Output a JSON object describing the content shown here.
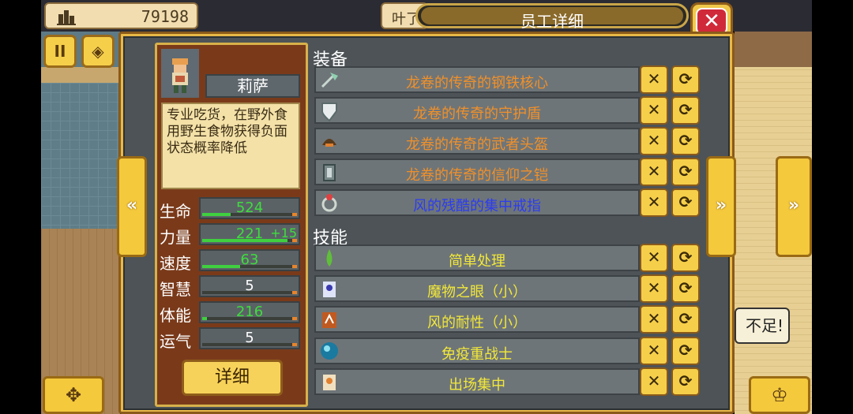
{
  "topbar": {
    "money": "79198",
    "name_partial": "叶了",
    "title": "员工详细",
    "close_label": "✕"
  },
  "left_buttons": {
    "pause_label": "II",
    "map_label": "◈"
  },
  "character": {
    "name": "莉萨",
    "description": "专业吃货，在野外食用野生食物获得负面状态概率降低",
    "stats": [
      {
        "label": "生命",
        "value": "524",
        "color": "#3fdc3f",
        "fill": 0.3
      },
      {
        "label": "力量",
        "value": "221",
        "bonus": "+15",
        "color": "#3fdc3f",
        "fill": 0.9
      },
      {
        "label": "速度",
        "value": "63",
        "color": "#3fdc3f",
        "fill": 0.4
      },
      {
        "label": "智慧",
        "value": "5",
        "color": "#ffffff",
        "fill": 0.0
      },
      {
        "label": "体能",
        "value": "216",
        "color": "#3fdc3f",
        "fill": 0.05
      },
      {
        "label": "运气",
        "value": "5",
        "color": "#ffffff",
        "fill": 0.0
      }
    ],
    "detail_button": "详细"
  },
  "equipment": {
    "title": "装备",
    "items": [
      {
        "name": "龙卷的传奇的钢铁核心",
        "color": "#f0902a",
        "icon": "axe-icon"
      },
      {
        "name": "龙卷的传奇的守护盾",
        "color": "#f0902a",
        "icon": "shield-icon"
      },
      {
        "name": "龙卷的传奇的武者头盔",
        "color": "#f0902a",
        "icon": "helmet-icon"
      },
      {
        "name": "龙卷的传奇的信仰之铠",
        "color": "#f0902a",
        "icon": "armor-icon"
      },
      {
        "name": "风的残酷的集中戒指",
        "color": "#2c3cf0",
        "icon": "ring-icon"
      }
    ]
  },
  "skills": {
    "title": "技能",
    "items": [
      {
        "name": "简单处理",
        "color": "#f2e83a",
        "icon": "potion-icon"
      },
      {
        "name": "魔物之眼（小）",
        "color": "#f2e83a",
        "icon": "monster-eye-icon"
      },
      {
        "name": "风的耐性（小）",
        "color": "#f2e83a",
        "icon": "wind-icon"
      },
      {
        "name": "免疫重战士",
        "color": "#f2e83a",
        "icon": "orb-icon"
      },
      {
        "name": "出场集中",
        "color": "#f2e83a",
        "icon": "focus-icon"
      }
    ]
  },
  "actions": {
    "remove_label": "✕",
    "swap_label": "⟳"
  },
  "nav": {
    "prev_label": "«",
    "next_label": "»",
    "far_next_label": "»"
  },
  "bottom": {
    "left_label": "✥",
    "right_label": "♔"
  },
  "background": {
    "speech_text": "不足!"
  }
}
